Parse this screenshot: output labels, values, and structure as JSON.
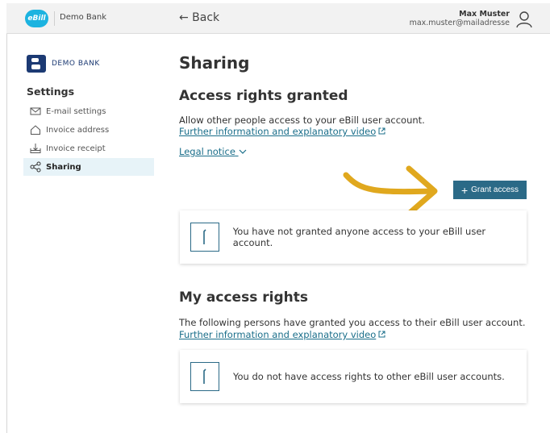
{
  "topbar": {
    "logo_text": "eBill",
    "bank_name": "Demo Bank",
    "back_label": "← Back",
    "user_name": "Max Muster",
    "user_email": "max.muster@mailadresse"
  },
  "sidebar": {
    "logo_text": "DEMO BANK",
    "title": "Settings",
    "items": [
      {
        "label": "E-mail settings",
        "icon": "envelope-icon"
      },
      {
        "label": "Invoice address",
        "icon": "home-icon"
      },
      {
        "label": "Invoice receipt",
        "icon": "inbox-icon"
      },
      {
        "label": "Sharing",
        "icon": "share-icon",
        "active": true
      }
    ]
  },
  "main": {
    "title": "Sharing",
    "granted": {
      "heading": "Access rights granted",
      "description": "Allow other people access to your eBill user account.",
      "info_link": "Further information and explanatory video",
      "legal_notice": "Legal notice",
      "grant_button": "Grant access",
      "empty_message": "You have not granted anyone access to your eBill user account."
    },
    "my_rights": {
      "heading": "My access rights",
      "description": "The following persons have granted you access to their eBill user account.",
      "info_link": "Further information and explanatory video",
      "empty_message": "You do not have access rights to other eBill user accounts."
    }
  },
  "colors": {
    "accent": "#2b6a87",
    "ebill_blue": "#1cb3e0",
    "link": "#1a6e8a",
    "arrow": "#e0a81e",
    "active_nav_bg": "#e7f3f8"
  }
}
